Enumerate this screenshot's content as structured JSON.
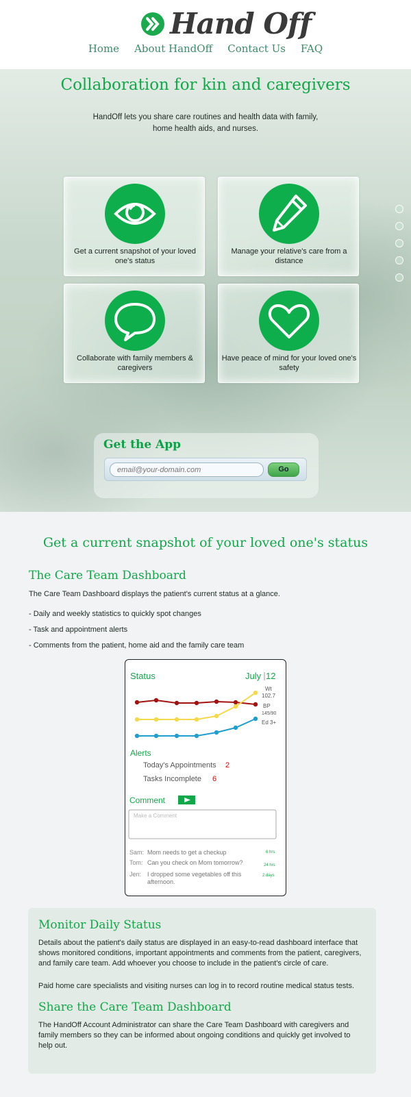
{
  "brand": {
    "name": "Hand Off",
    "accent": "#12a84a"
  },
  "nav": [
    "Home",
    "About HandOff",
    "Contact Us",
    "FAQ"
  ],
  "hero": {
    "title": "Collaboration for kin and caregivers",
    "subtitle": "HandOff lets you share care routines and health data with family, home health aids, and nurses.",
    "features": [
      {
        "icon": "eye-icon",
        "caption": "Get a current snapshot of your loved one's status"
      },
      {
        "icon": "pencil-icon",
        "caption": "Manage your relative's care from a distance"
      },
      {
        "icon": "speech-bubble-icon",
        "caption": "Collaborate with family members & caregivers"
      },
      {
        "icon": "heart-icon",
        "caption": "Have peace of mind for your loved one's safety"
      }
    ],
    "app": {
      "title": "Get the App",
      "placeholder": "email@your-domain.com",
      "button": "Go"
    }
  },
  "snapshot": {
    "title": "Get a current snapshot of your loved one's status",
    "dashboard_heading": "The Care Team Dashboard",
    "dashboard_desc": "The Care Team Dashboard displays the patient's current status at a glance.",
    "bullets": [
      "- Daily and weekly statistics to quickly spot changes",
      "- Task and appointment alerts",
      "- Comments from the patient, home aid and the family care team"
    ]
  },
  "dashboard": {
    "status_label": "Status",
    "date_month": "July",
    "date_day": "12",
    "legend": {
      "wt": "Wt",
      "wt_val": "102.7",
      "bp": "BP",
      "bp_val": "145/90",
      "ed": "Ed 3+"
    },
    "series_colors": [
      "#a3120f",
      "#f5d94a",
      "#1f9fcf"
    ],
    "alerts_label": "Alerts",
    "appointments_label": "Today's Appointments",
    "appointments_count": "2",
    "tasks_label": "Tasks Incomplete",
    "tasks_count": "6",
    "comment_label": "Comment",
    "comment_placeholder": "Make a Comment",
    "comments": [
      {
        "who": "Sam:",
        "text": "Mom needs to get a checkup",
        "age": "6 hrs"
      },
      {
        "who": "Tom:",
        "text": "Can you check on Mom tomorrow?",
        "age": "24 hrs"
      },
      {
        "who": "Jen:",
        "text": "I dropped some vegetables off this afternoon.",
        "age": "2 days"
      }
    ]
  },
  "monitor": {
    "heading": "Monitor Daily Status",
    "p1": "Details about the patient's daily status are displayed in an easy-to-read dashboard interface that shows monitored conditions, important appointments and comments from the patient, caregivers, and family care team. Add whoever you choose to include in the patient's circle of care.",
    "p2": "Paid home care specialists and visiting nurses can log in to record routine medical status tests.",
    "share_heading": "Share the Care Team Dashboard",
    "p3": "The HandOff Account Administrator can share the Care Team Dashboard with caregivers and family members so they can be informed about ongoing conditions and quickly get involved to help out."
  }
}
